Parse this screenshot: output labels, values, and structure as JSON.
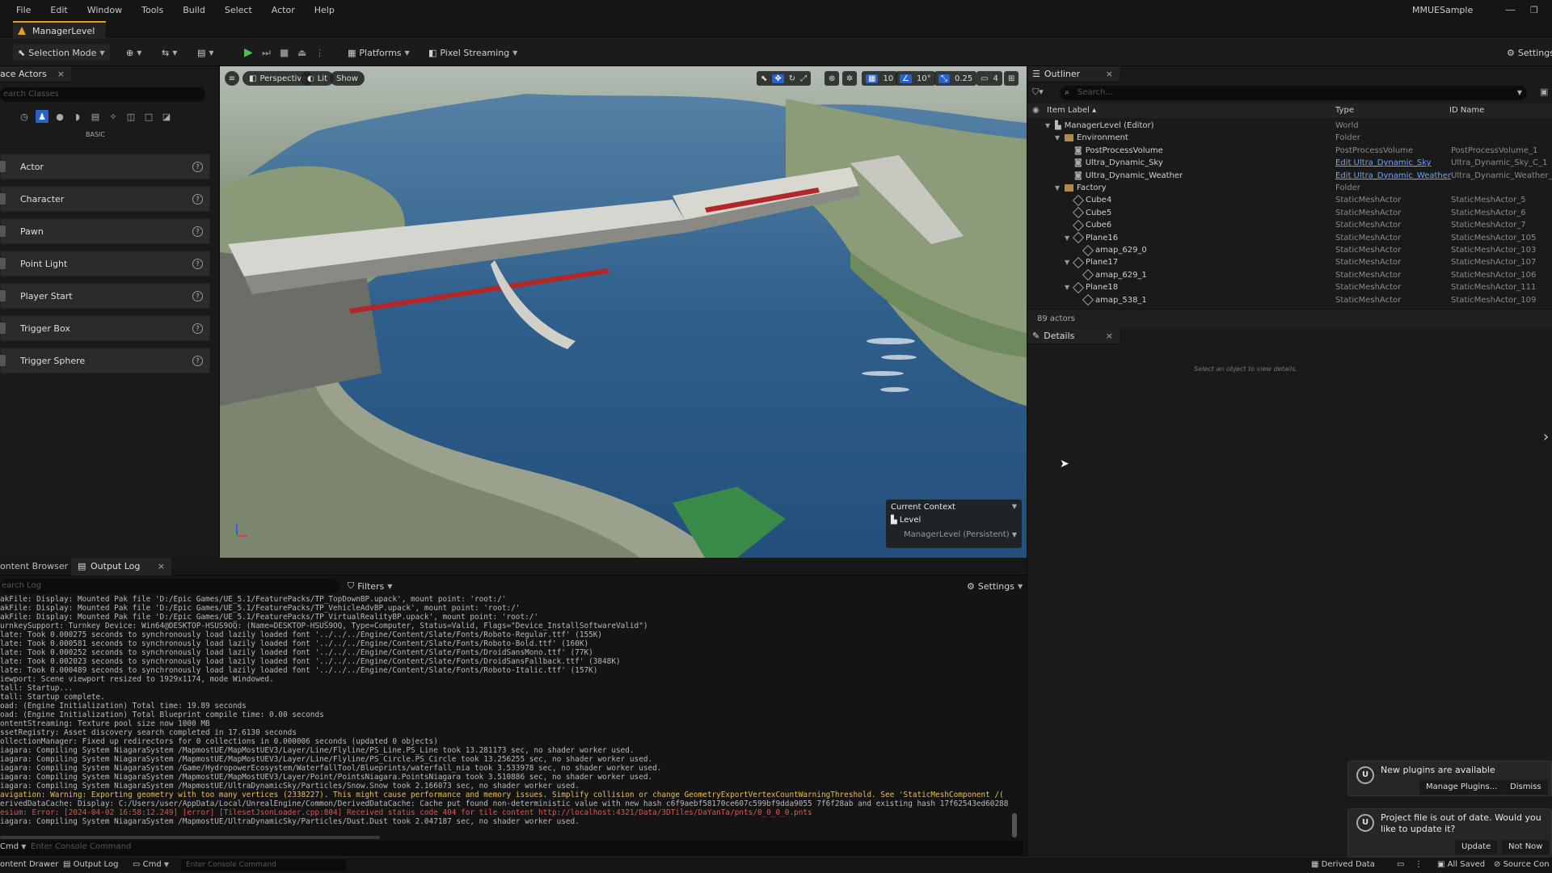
{
  "menu": [
    "File",
    "Edit",
    "Window",
    "Tools",
    "Build",
    "Select",
    "Actor",
    "Help"
  ],
  "project_name": "MMUESample",
  "level_tab": "ManagerLevel",
  "toolbar": {
    "selection_mode": "Selection Mode",
    "platforms": "Platforms",
    "pixel_streaming": "Pixel Streaming",
    "settings": "Settings"
  },
  "place_actors": {
    "tab": "ace Actors",
    "search_placeholder": "earch Classes",
    "category": "BASIC",
    "items": [
      "Actor",
      "Character",
      "Pawn",
      "Point Light",
      "Player Start",
      "Trigger Box",
      "Trigger Sphere"
    ]
  },
  "viewport": {
    "perspective": "Perspective",
    "lit": "Lit",
    "show": "Show",
    "grid_size": "10",
    "rotation_snap": "10°",
    "scale_snap": "0.25",
    "camera_speed": "4",
    "context_title": "Current Context",
    "context_level": "Level",
    "context_value": "ManagerLevel (Persistent)"
  },
  "outliner": {
    "tab": "Outliner",
    "search_placeholder": "Search...",
    "columns": [
      "Item Label",
      "Type",
      "ID Name"
    ],
    "rows": [
      {
        "label": "ManagerLevel (Editor)",
        "type": "World",
        "id": "",
        "indent": 0,
        "icon": "world"
      },
      {
        "label": "Environment",
        "type": "Folder",
        "id": "",
        "indent": 1,
        "icon": "folder"
      },
      {
        "label": "PostProcessVolume",
        "type": "PostProcessVolume",
        "id": "PostProcessVolume_1",
        "indent": 2,
        "icon": "actor"
      },
      {
        "label": "Ultra_Dynamic_Sky",
        "type": "Edit Ultra_Dynamic_Sky",
        "id": "Ultra_Dynamic_Sky_C_1",
        "indent": 2,
        "icon": "actor",
        "link": true
      },
      {
        "label": "Ultra_Dynamic_Weather",
        "type": "Edit Ultra_Dynamic_Weather",
        "id": "Ultra_Dynamic_Weather_C_",
        "indent": 2,
        "icon": "actor",
        "link": true
      },
      {
        "label": "Factory",
        "type": "Folder",
        "id": "",
        "indent": 1,
        "icon": "folder"
      },
      {
        "label": "Cube4",
        "type": "StaticMeshActor",
        "id": "StaticMeshActor_5",
        "indent": 2,
        "icon": "mesh"
      },
      {
        "label": "Cube5",
        "type": "StaticMeshActor",
        "id": "StaticMeshActor_6",
        "indent": 2,
        "icon": "mesh"
      },
      {
        "label": "Cube6",
        "type": "StaticMeshActor",
        "id": "StaticMeshActor_7",
        "indent": 2,
        "icon": "mesh"
      },
      {
        "label": "Plane16",
        "type": "StaticMeshActor",
        "id": "StaticMeshActor_105",
        "indent": 2,
        "icon": "mesh"
      },
      {
        "label": "amap_629_0",
        "type": "StaticMeshActor",
        "id": "StaticMeshActor_103",
        "indent": 3,
        "icon": "mesh"
      },
      {
        "label": "Plane17",
        "type": "StaticMeshActor",
        "id": "StaticMeshActor_107",
        "indent": 2,
        "icon": "mesh"
      },
      {
        "label": "amap_629_1",
        "type": "StaticMeshActor",
        "id": "StaticMeshActor_106",
        "indent": 3,
        "icon": "mesh"
      },
      {
        "label": "Plane18",
        "type": "StaticMeshActor",
        "id": "StaticMeshActor_111",
        "indent": 2,
        "icon": "mesh"
      },
      {
        "label": "amap_538_1",
        "type": "StaticMeshActor",
        "id": "StaticMeshActor_109",
        "indent": 3,
        "icon": "mesh"
      }
    ],
    "actor_count": "89 actors"
  },
  "details": {
    "tab": "Details",
    "empty_text": "Select an object to view details."
  },
  "bottom": {
    "content_browser_tab": "ontent Browser",
    "output_log_tab": "Output Log",
    "search_placeholder": "earch Log",
    "filters": "Filters",
    "settings": "Settings",
    "cmd": "Cmd",
    "console_placeholder": "Enter Console Command",
    "log_lines": [
      {
        "t": "akFile: Display: Mounted Pak file 'D:/Epic Games/UE_5.1/FeaturePacks/TP_TopDownBP.upack', mount point: 'root:/'",
        "k": "n"
      },
      {
        "t": "akFile: Display: Mounted Pak file 'D:/Epic Games/UE_5.1/FeaturePacks/TP_VehicleAdvBP.upack', mount point: 'root:/'",
        "k": "n"
      },
      {
        "t": "akFile: Display: Mounted Pak file 'D:/Epic Games/UE_5.1/FeaturePacks/TP_VirtualRealityBP.upack', mount point: 'root:/'",
        "k": "n"
      },
      {
        "t": "urnkeySupport: Turnkey Device: Win64@DESKTOP-HSUS9OQ: (Name=DESKTOP-HSUS9OQ, Type=Computer, Status=Valid, Flags=\"Device_InstallSoftwareValid\")",
        "k": "n"
      },
      {
        "t": "late: Took 0.000275 seconds to synchronously load lazily loaded font '../../../Engine/Content/Slate/Fonts/Roboto-Regular.ttf' (155K)",
        "k": "n"
      },
      {
        "t": "late: Took 0.000581 seconds to synchronously load lazily loaded font '../../../Engine/Content/Slate/Fonts/Roboto-Bold.ttf' (160K)",
        "k": "n"
      },
      {
        "t": "late: Took 0.000252 seconds to synchronously load lazily loaded font '../../../Engine/Content/Slate/Fonts/DroidSansMono.ttf' (77K)",
        "k": "n"
      },
      {
        "t": "late: Took 0.002023 seconds to synchronously load lazily loaded font '../../../Engine/Content/Slate/Fonts/DroidSansFallback.ttf' (3848K)",
        "k": "n"
      },
      {
        "t": "late: Took 0.000489 seconds to synchronously load lazily loaded font '../../../Engine/Content/Slate/Fonts/Roboto-Italic.ttf' (157K)",
        "k": "n"
      },
      {
        "t": "iewport: Scene viewport resized to 1929x1174, mode Windowed.",
        "k": "n"
      },
      {
        "t": "tall: Startup...",
        "k": "n"
      },
      {
        "t": "tall: Startup complete.",
        "k": "n"
      },
      {
        "t": "oad: (Engine Initialization) Total time: 19.89 seconds",
        "k": "n"
      },
      {
        "t": "oad: (Engine Initialization) Total Blueprint compile time: 0.00 seconds",
        "k": "n"
      },
      {
        "t": "ontentStreaming: Texture pool size now 1000 MB",
        "k": "n"
      },
      {
        "t": "ssetRegistry: Asset discovery search completed in 17.6130 seconds",
        "k": "n"
      },
      {
        "t": "ollectionManager: Fixed up redirectors for 0 collections in 0.000006 seconds (updated 0 objects)",
        "k": "n"
      },
      {
        "t": "iagara: Compiling System NiagaraSystem /MapmostUE/MapMostUEV3/Layer/Line/Flyline/PS_Line.PS_Line took 13.281173 sec, no shader worker used.",
        "k": "n"
      },
      {
        "t": "iagara: Compiling System NiagaraSystem /MapmostUE/MapMostUEV3/Layer/Line/Flyline/PS_Circle.PS_Circle took 13.256255 sec, no shader worker used.",
        "k": "n"
      },
      {
        "t": "iagara: Compiling System NiagaraSystem /Game/HydropowerEcosystem/WaterfallTool/Blueprints/waterfall_nia took 3.533978 sec, no shader worker used.",
        "k": "n"
      },
      {
        "t": "iagara: Compiling System NiagaraSystem /MapmostUE/MapMostUEV3/Layer/Point/PointsNiagara.PointsNiagara took 3.510886 sec, no shader worker used.",
        "k": "n"
      },
      {
        "t": "iagara: Compiling System NiagaraSystem /MapmostUE/UltraDynamicSky/Particles/Snow.Snow took 2.166073 sec, no shader worker used.",
        "k": "n"
      },
      {
        "t": "avigation: Warning: Exporting geometry with too many vertices (2338227). This might cause performance and memory issues. Simplify collision or change GeometryExportVertexCountWarningThreshold. See 'StaticMeshComponent /(",
        "k": "w"
      },
      {
        "t": "erivedDataCache: Display: C:/Users/user/AppData/Local/UnrealEngine/Common/DerivedDataCache: Cache put found non-deterministic value with new hash c6f9aebf58170ce607c599bf9dda9055 7f6f28ab and existing hash 17f62543ed60288",
        "k": "n"
      },
      {
        "t": "esium: Error: [2024-04-02 16:58:12.249] [error] [TilesetJsonLoader.cpp:804] Received status code 404 for tile content http://localhost:4321/Data/3DTiles/DaYanTa/pnts/0_0_0_0.pnts",
        "k": "e"
      },
      {
        "t": "iagara: Compiling System NiagaraSystem /MapmostUE/UltraDynamicSky/Particles/Dust.Dust took 2.047187 sec, no shader worker used.",
        "k": "n"
      }
    ]
  },
  "status_bar": {
    "content_drawer": "ontent Drawer",
    "output_log": "Output Log",
    "cmd": "Cmd",
    "console_placeholder": "Enter Console Command",
    "derived_data": "Derived Data",
    "all_saved": "All Saved",
    "source_control": "Source Con"
  },
  "toasts": {
    "plugins_title": "New plugins are available",
    "manage_plugins": "Manage Plugins...",
    "dismiss": "Dismiss",
    "project_title": "Project file is out of date. Would you like to update it?",
    "update": "Update",
    "not_now": "Not Now"
  },
  "colors": {
    "accent": "#2a62c9",
    "warning": "#e8c040",
    "error": "#e05050",
    "link": "#6ea4ff",
    "play": "#4fbf4f"
  }
}
